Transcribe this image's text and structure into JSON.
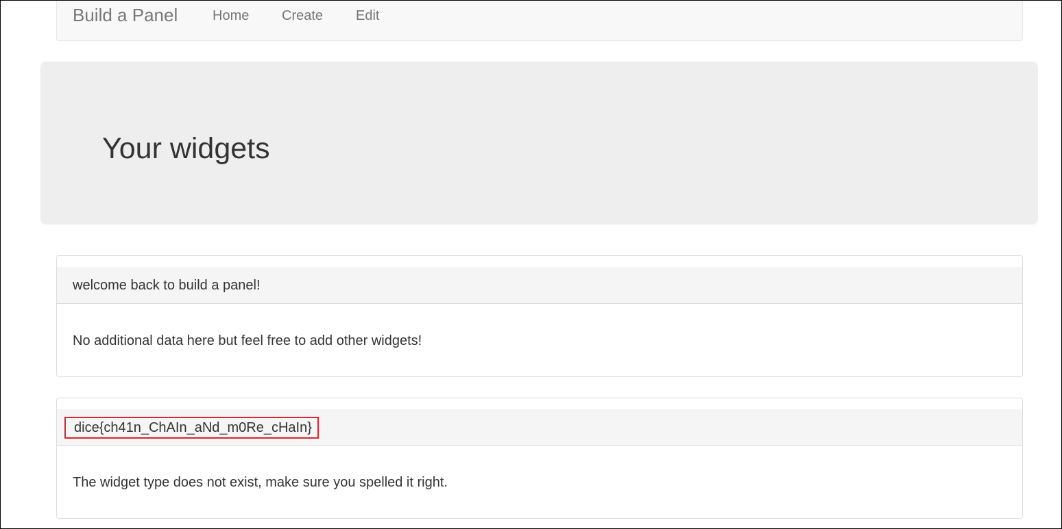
{
  "navbar": {
    "brand": "Build a Panel",
    "links": [
      {
        "label": "Home"
      },
      {
        "label": "Create"
      },
      {
        "label": "Edit"
      }
    ]
  },
  "jumbotron": {
    "title": "Your widgets"
  },
  "widgets": [
    {
      "title": "welcome back to build a panel!",
      "body": "No additional data here but feel free to add other widgets!"
    },
    {
      "title": "dice{ch41n_ChAIn_aNd_m0Re_cHaIn}",
      "body": "The widget type does not exist, make sure you spelled it right.",
      "highlight_color": "#d9262f"
    }
  ]
}
